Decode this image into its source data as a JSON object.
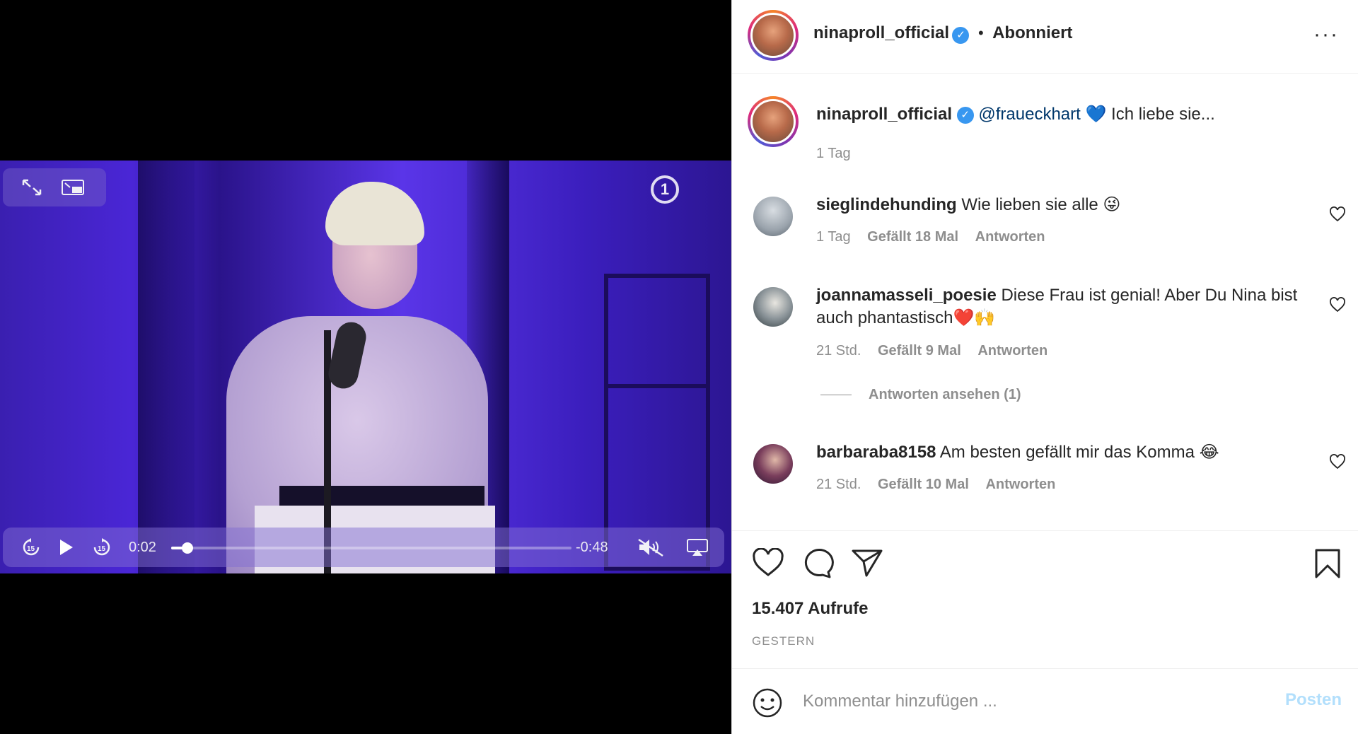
{
  "video": {
    "logo": "1",
    "controls": {
      "elapsed": "0:02",
      "remaining": "-0:48",
      "progress": 0.04,
      "muted": true
    },
    "icons": [
      "fullscreen-icon",
      "picture-in-picture-icon",
      "skip-back-15-icon",
      "play-icon",
      "skip-forward-15-icon",
      "mute-icon",
      "airplay-icon"
    ]
  },
  "header": {
    "username": "ninaproll_official",
    "verified": true,
    "separator": "•",
    "follow_status": "Abonniert",
    "more": "···"
  },
  "caption": {
    "username": "ninaproll_official",
    "mention": "@fraueckhart",
    "emoji": "💙",
    "text": "Ich liebe sie...",
    "time": "1 Tag"
  },
  "comments": [
    {
      "username": "sieglindehunding",
      "text": "Wie lieben sie alle 😜",
      "time": "1 Tag",
      "likes": "Gefällt 18 Mal",
      "reply": "Antworten",
      "avatar_color": "#9aa3ac"
    },
    {
      "username": "joannamasseli_poesie",
      "text": "Diese Frau ist genial! Aber Du Nina bist auch phantastisch❤️🙌",
      "time": "21 Std.",
      "likes": "Gefällt 9 Mal",
      "reply": "Antworten",
      "view_replies": "Antworten ansehen (1)",
      "avatar_color": "#7d8a8f"
    },
    {
      "username": "barbaraba8158",
      "text": "Am besten gefällt mir das Komma 😂",
      "time": "21 Std.",
      "likes": "Gefällt 10 Mal",
      "reply": "Antworten",
      "avatar_color": "#4a2a5a"
    }
  ],
  "actions": {
    "views": "15.407 Aufrufe",
    "date": "GESTERN"
  },
  "add_comment": {
    "placeholder": "Kommentar hinzufügen ...",
    "post_label": "Posten"
  },
  "colors": {
    "link": "#00376b",
    "verified": "#3897f0",
    "muted_text": "#8e8e8e",
    "post_disabled": "#b2dffc"
  }
}
